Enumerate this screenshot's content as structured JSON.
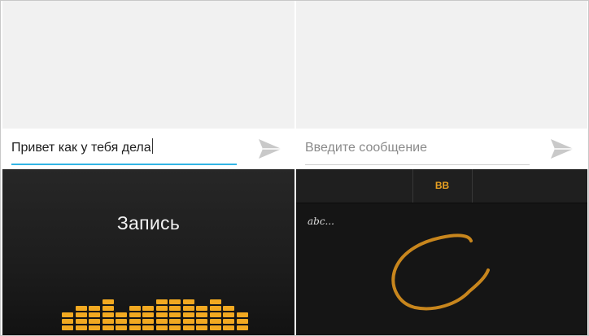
{
  "left_panel": {
    "message_input": {
      "value": "Привет как у тебя дела"
    },
    "send_icon": "send-icon",
    "voice_keyboard": {
      "label": "Запись",
      "level_color": "#f2a921",
      "levels": [
        3,
        4,
        4,
        5,
        3,
        4,
        4,
        5,
        5,
        5,
        4,
        5,
        4,
        3
      ]
    }
  },
  "right_panel": {
    "message_input": {
      "placeholder": "Введите сообщение"
    },
    "send_icon": "send-icon",
    "handwriting_keyboard": {
      "tab_label": "BB",
      "hint": "abc...",
      "ink_color": "#c8861d"
    }
  },
  "colors": {
    "input_accent": "#33b5e5",
    "keyboard_accent": "#e8a021",
    "keyboard_background": "#151515"
  }
}
